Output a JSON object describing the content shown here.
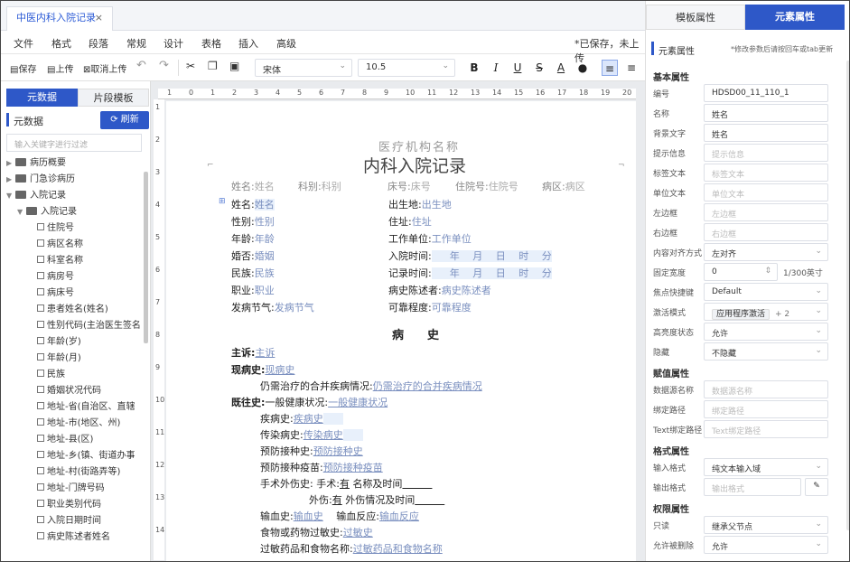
{
  "tab": {
    "title": "中医内科入院记录",
    "close": "×"
  },
  "menu": [
    "文件",
    "格式",
    "段落",
    "常规",
    "设计",
    "表格",
    "插入",
    "高级"
  ],
  "save_status": "*已保存，未上传",
  "toolbar": {
    "save": "保存",
    "upload": "上传",
    "cancel_upload": "取消上传",
    "font": "宋体",
    "size": "10.5"
  },
  "left": {
    "tabs": [
      "元数据",
      "片段模板"
    ],
    "section": "元数据",
    "refresh": "刷新",
    "filter_placeholder": "输入关键字进行过滤",
    "tree": [
      {
        "label": "病历概要",
        "lvl": 0,
        "type": "folder"
      },
      {
        "label": "门急诊病历",
        "lvl": 0,
        "type": "folder"
      },
      {
        "label": "入院记录",
        "lvl": 0,
        "type": "folder-open"
      },
      {
        "label": "入院记录",
        "lvl": 1,
        "type": "folder-open"
      },
      {
        "label": "住院号",
        "lvl": 2,
        "type": "leaf"
      },
      {
        "label": "病区名称",
        "lvl": 2,
        "type": "leaf"
      },
      {
        "label": "科室名称",
        "lvl": 2,
        "type": "leaf"
      },
      {
        "label": "病房号",
        "lvl": 2,
        "type": "leaf"
      },
      {
        "label": "病床号",
        "lvl": 2,
        "type": "leaf"
      },
      {
        "label": "患者姓名(姓名)",
        "lvl": 2,
        "type": "leaf"
      },
      {
        "label": "性别代码(主治医生签名",
        "lvl": 2,
        "type": "leaf"
      },
      {
        "label": "年龄(岁)",
        "lvl": 2,
        "type": "leaf"
      },
      {
        "label": "年龄(月)",
        "lvl": 2,
        "type": "leaf"
      },
      {
        "label": "民族",
        "lvl": 2,
        "type": "leaf"
      },
      {
        "label": "婚姻状况代码",
        "lvl": 2,
        "type": "leaf"
      },
      {
        "label": "地址-省(自治区、直辖",
        "lvl": 2,
        "type": "leaf"
      },
      {
        "label": "地址-市(地区、州)",
        "lvl": 2,
        "type": "leaf"
      },
      {
        "label": "地址-县(区)",
        "lvl": 2,
        "type": "leaf"
      },
      {
        "label": "地址-乡(镇、街道办事",
        "lvl": 2,
        "type": "leaf"
      },
      {
        "label": "地址-村(街路弄等)",
        "lvl": 2,
        "type": "leaf"
      },
      {
        "label": "地址-门牌号码",
        "lvl": 2,
        "type": "leaf"
      },
      {
        "label": "职业类别代码",
        "lvl": 2,
        "type": "leaf"
      },
      {
        "label": "入院日期时间",
        "lvl": 2,
        "type": "leaf"
      },
      {
        "label": "病史陈述者姓名",
        "lvl": 2,
        "type": "leaf"
      }
    ]
  },
  "ruler": {
    "h": [
      "1",
      "0",
      "1",
      "2",
      "3",
      "4",
      "5",
      "6",
      "7",
      "8",
      "9",
      "10",
      "11",
      "12",
      "13",
      "14",
      "15",
      "16",
      "17",
      "18",
      "19",
      "20"
    ],
    "v": [
      "1",
      "2",
      "3",
      "4",
      "5",
      "6",
      "7",
      "8",
      "9",
      "10",
      "11",
      "12",
      "13",
      "14"
    ]
  },
  "doc": {
    "org": "医疗机构名称",
    "title": "内科入院记录",
    "header": {
      "name_l": "姓名:",
      "name_v": "姓名",
      "dept_l": "科别:",
      "dept_v": "科别",
      "bed_l": "床号:",
      "bed_v": "床号",
      "inp_l": "住院号:",
      "inp_v": "住院号",
      "ward_l": "病区:",
      "ward_v": "病区"
    },
    "left_fields": [
      {
        "l": "姓名:",
        "v": "姓名"
      },
      {
        "l": "性别:",
        "v": "性别"
      },
      {
        "l": "年龄:",
        "v": "年龄"
      },
      {
        "l": "婚否:",
        "v": "婚姻"
      },
      {
        "l": "民族:",
        "v": "民族"
      },
      {
        "l": "职业:",
        "v": "职业"
      },
      {
        "l": "发病节气:",
        "v": "发病节气"
      }
    ],
    "right_fields": [
      {
        "l": "出生地:",
        "v": "出生地"
      },
      {
        "l": "住址:",
        "v": "住址"
      },
      {
        "l": "工作单位:",
        "v": "工作单位"
      },
      {
        "l": "入院时间:",
        "v": "年　 月　 日　 时　 分"
      },
      {
        "l": "记录时间:",
        "v": "年　 月　 日　 时　 分"
      },
      {
        "l": "病史陈述者:",
        "v": "病史陈述者"
      },
      {
        "l": "可靠程度:",
        "v": "可靠程度"
      }
    ],
    "history_title": "病　　史",
    "chief_l": "主诉:",
    "chief_v": "主诉",
    "present_l": "现病史:",
    "present_v": "现病史",
    "comorb_l": "仍需治疗的合并疾病情况:",
    "comorb_v": "仍需治疗的合并疾病情况",
    "past_l": "既往史:",
    "general_l": "一般健康状况:",
    "general_v": "一般健康状况",
    "disease_l": "疾病史:",
    "disease_v": "疾病史",
    "infect_l": "传染病史:",
    "infect_v": "传染病史",
    "vacc_l": "预防接种史:",
    "vacc_v": "预防接种史",
    "vaccine_l": "预防接种疫苗:",
    "vaccine_v": "预防接种疫苗",
    "surg_l": "手术外伤史:",
    "surg2_l": "手术:",
    "surg2_v": "有",
    "surg3_l": "名称及时间",
    "trauma_l": "外伤:",
    "trauma_v": "有",
    "trauma2_l": "外伤情况及时间",
    "trans_l": "输血史:",
    "trans_v": "输血史",
    "react_l": "输血反应:",
    "react_v": "输血反应",
    "allergy_l": "食物或药物过敏史:",
    "allergy_v": "过敏史",
    "allergy2_l": "过敏药品和食物名称:",
    "allergy2_v": "过敏药品和食物名称"
  },
  "right": {
    "tabs": [
      "模板属性",
      "元素属性"
    ],
    "head": "元素属性",
    "tip": "*修改参数后请按回车或tab更新",
    "sections": {
      "basic": "基本属性",
      "assign": "赋值属性",
      "format": "格式属性",
      "perm": "权限属性"
    },
    "rows": [
      {
        "l": "编号",
        "v": "HDSD00_11_110_1",
        "ph": false
      },
      {
        "l": "名称",
        "v": "姓名",
        "ph": false
      },
      {
        "l": "背景文字",
        "v": "姓名",
        "ph": false
      },
      {
        "l": "提示信息",
        "v": "提示信息",
        "ph": true
      },
      {
        "l": "标签文本",
        "v": "标签文本",
        "ph": true
      },
      {
        "l": "单位文本",
        "v": "单位文本",
        "ph": true
      },
      {
        "l": "左边框",
        "v": "左边框",
        "ph": true
      },
      {
        "l": "右边框",
        "v": "右边框",
        "ph": true
      },
      {
        "l": "内容对齐方式",
        "v": "左对齐",
        "ph": false,
        "dd": true
      },
      {
        "l": "固定宽度",
        "v": "0",
        "ph": false,
        "unit": "1/300英寸"
      },
      {
        "l": "焦点快捷键",
        "v": "Default",
        "ph": false,
        "dd": true
      },
      {
        "l": "激活模式",
        "v": "应用程序激活",
        "ph": false,
        "dd": true,
        "extra": "+ 2"
      },
      {
        "l": "高亮度状态",
        "v": "允许",
        "ph": false,
        "dd": true
      },
      {
        "l": "隐藏",
        "v": "不隐藏",
        "ph": false,
        "dd": true
      },
      {
        "l": "数据源名称",
        "v": "数据源名称",
        "ph": true
      },
      {
        "l": "绑定路径",
        "v": "绑定路径",
        "ph": true
      },
      {
        "l": "Text绑定路径",
        "v": "Text绑定路径",
        "ph": true
      },
      {
        "l": "输入格式",
        "v": "纯文本输入域",
        "ph": false,
        "dd": true
      },
      {
        "l": "输出格式",
        "v": "输出格式",
        "ph": true
      },
      {
        "l": "只读",
        "v": "继承父节点",
        "ph": false,
        "dd": true
      },
      {
        "l": "允许被删除",
        "v": "允许",
        "ph": false,
        "dd": true
      }
    ]
  }
}
